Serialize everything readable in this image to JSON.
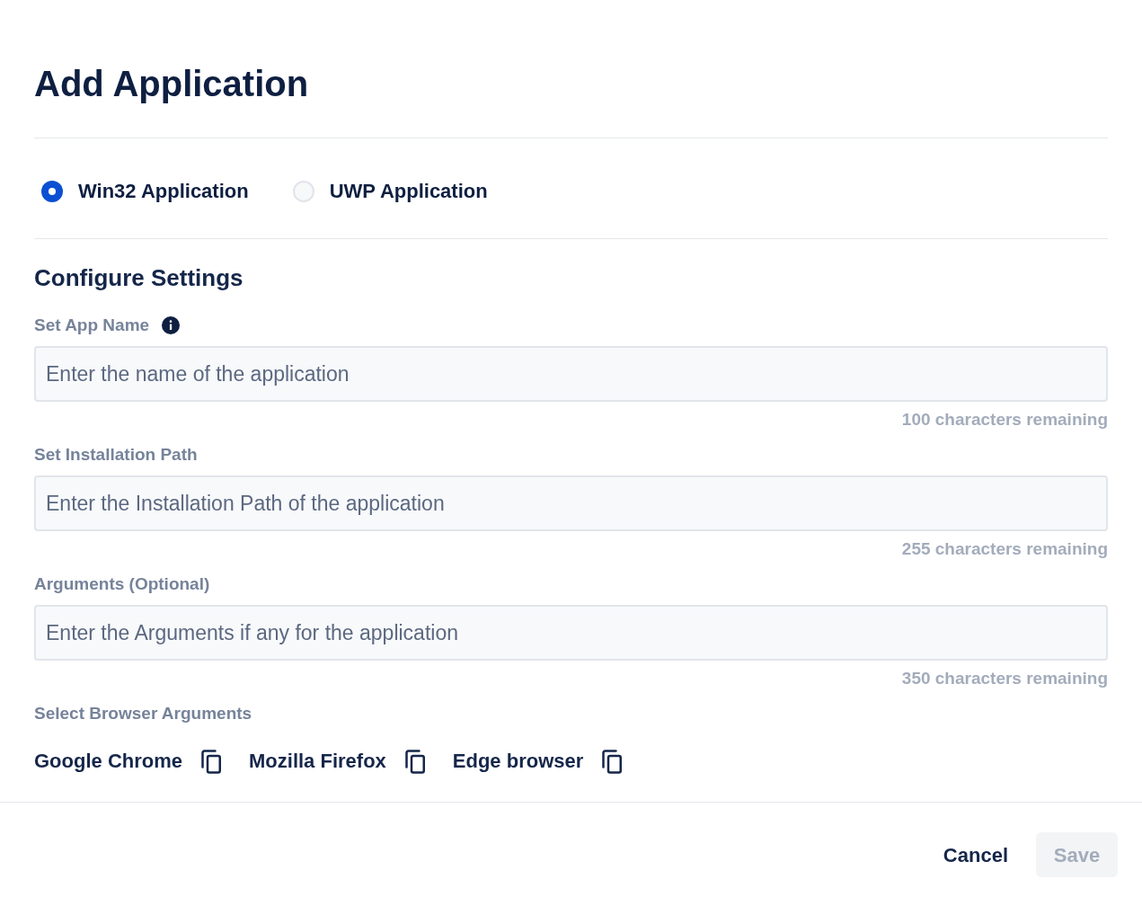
{
  "dialog": {
    "title": "Add Application"
  },
  "app_types": [
    {
      "label": "Win32 Application",
      "selected": true
    },
    {
      "label": "UWP Application",
      "selected": false
    }
  ],
  "section": {
    "title": "Configure Settings"
  },
  "fields": [
    {
      "label": "Set App Name",
      "info": true,
      "placeholder": "Enter the name of the application",
      "helper": "100 characters remaining"
    },
    {
      "label": "Set Installation Path",
      "info": false,
      "placeholder": "Enter the Installation Path of the application",
      "helper": "255 characters remaining"
    },
    {
      "label": "Arguments (Optional)",
      "info": false,
      "placeholder": "Enter the Arguments if any for the application",
      "helper": "350 characters remaining"
    }
  ],
  "browser_arguments": {
    "label": "Select Browser Arguments",
    "browsers": [
      "Google Chrome",
      "Mozilla Firefox",
      "Edge browser"
    ]
  },
  "buttons": [
    {
      "label": "Cancel",
      "kind": "text",
      "disabled": false
    },
    {
      "label": "Save",
      "kind": "filled",
      "disabled": true
    }
  ]
}
